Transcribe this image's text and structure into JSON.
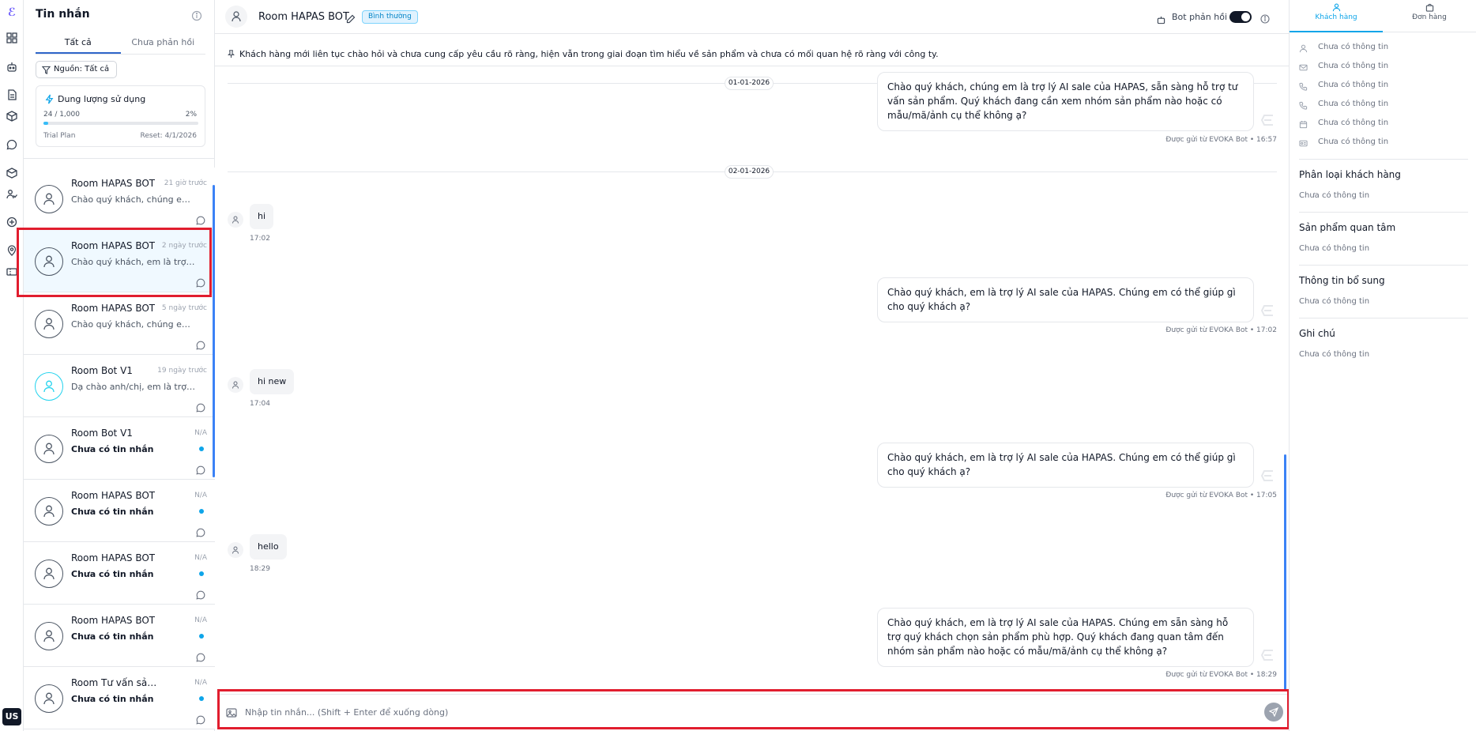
{
  "rail": {
    "user_badge": "US"
  },
  "conversations": {
    "title": "Tin nhắn",
    "tabs": [
      "Tất cả",
      "Chưa phản hồi"
    ],
    "filter_label": "Nguồn: Tất cả",
    "usage": {
      "title": "Dung lượng sử dụng",
      "count": "24 / 1,000",
      "percent_label": "2%",
      "percent": 2.4,
      "plan": "Trial Plan",
      "reset": "Reset: 4/1/2026"
    },
    "rooms": [
      {
        "name": "Room HAPAS BOT",
        "time": "21 giờ trước",
        "preview": "Chào quý khách, chúng em là trợ lý AI sale của HAPAS",
        "unread": false,
        "selected": false,
        "avatar": "gray"
      },
      {
        "name": "Room HAPAS BOT",
        "time": "2 ngày trước",
        "preview": "Chào quý khách, em là trợ lý AI sale của HAPAS",
        "unread": false,
        "selected": true,
        "avatar": "gray"
      },
      {
        "name": "Room HAPAS BOT",
        "time": "5 ngày trước",
        "preview": "Chào quý khách, chúng em là trợ lý AI sale của HAPAS",
        "unread": false,
        "selected": false,
        "avatar": "gray"
      },
      {
        "name": "Room Bot V1",
        "time": "19 ngày trước",
        "preview": "Dạ chào anh/chị, em là trợ lý AI sale",
        "unread": false,
        "selected": false,
        "avatar": "cyan"
      },
      {
        "name": "Room Bot V1",
        "time": "N/A",
        "preview": "Chưa có tin nhắn",
        "unread": true,
        "selected": false,
        "avatar": "gray"
      },
      {
        "name": "Room HAPAS BOT",
        "time": "N/A",
        "preview": "Chưa có tin nhắn",
        "unread": true,
        "selected": false,
        "avatar": "gray"
      },
      {
        "name": "Room HAPAS BOT",
        "time": "N/A",
        "preview": "Chưa có tin nhắn",
        "unread": true,
        "selected": false,
        "avatar": "gray"
      },
      {
        "name": "Room HAPAS BOT",
        "time": "N/A",
        "preview": "Chưa có tin nhắn",
        "unread": true,
        "selected": false,
        "avatar": "gray"
      },
      {
        "name": "Room Tư vấn sản phẩm mới",
        "time": "N/A",
        "preview": "Chưa có tin nhắn",
        "unread": true,
        "selected": false,
        "avatar": "gray"
      }
    ]
  },
  "chat": {
    "title": "Room HAPAS BOT",
    "badge": "Bình thường",
    "bot_reply_label": "Bot phản hồi",
    "bot_reply_on": true,
    "summary": "Khách hàng mới liên tục chào hỏi và chưa cung cấp yêu cầu rõ ràng, hiện vẫn trong giai đoạn tìm hiểu về sản phẩm và chưa có mối quan hệ rõ ràng với công ty.",
    "dates": [
      "01-01-2026",
      "02-01-2026"
    ],
    "bot_messages": [
      {
        "text": "Chào quý khách, chúng em là trợ lý AI sale của HAPAS, sẵn sàng hỗ trợ tư vấn sản phẩm. Quý khách đang cần xem nhóm sản phẩm nào hoặc có mẫu/mã/ảnh cụ thể không ạ?",
        "meta": "Được gửi từ EVOKA Bot • 16:57"
      },
      {
        "text": "Chào quý khách, em là trợ lý AI sale của HAPAS. Chúng em có thể giúp gì cho quý khách ạ?",
        "meta": "Được gửi từ EVOKA Bot • 17:02"
      },
      {
        "text": "Chào quý khách, em là trợ lý AI sale của HAPAS. Chúng em có thể giúp gì cho quý khách ạ?",
        "meta": "Được gửi từ EVOKA Bot • 17:05"
      },
      {
        "text": "Chào quý khách, em là trợ lý AI sale của HAPAS. Chúng em sẵn sàng hỗ trợ quý khách chọn sản phẩm phù hợp. Quý khách đang quan tâm đến nhóm sản phẩm nào hoặc có mẫu/mã/ảnh cụ thể không ạ?",
        "meta": "Được gửi từ EVOKA Bot • 18:29"
      }
    ],
    "user_messages": [
      {
        "text": "hi",
        "time": "17:02"
      },
      {
        "text": "hi new",
        "time": "17:04"
      },
      {
        "text": "hello",
        "time": "18:29"
      }
    ],
    "composer_placeholder": "Nhập tin nhắn... (Shift + Enter để xuống dòng)"
  },
  "side": {
    "tabs": [
      "Khách hàng",
      "Đơn hàng"
    ],
    "info_rows": [
      {
        "icon": "user-icon",
        "text": "Chưa có thông tin"
      },
      {
        "icon": "mail-icon",
        "text": "Chưa có thông tin"
      },
      {
        "icon": "phone-icon",
        "text": "Chưa có thông tin"
      },
      {
        "icon": "phone-alt-icon",
        "text": "Chưa có thông tin"
      },
      {
        "icon": "calendar-icon",
        "text": "Chưa có thông tin"
      },
      {
        "icon": "id-card-icon",
        "text": "Chưa có thông tin"
      }
    ],
    "sections": [
      {
        "title": "Phân loại khách hàng",
        "value": "Chưa có thông tin"
      },
      {
        "title": "Sản phẩm quan tâm",
        "value": "Chưa có thông tin"
      },
      {
        "title": "Thông tin bổ sung",
        "value": "Chưa có thông tin"
      },
      {
        "title": "Ghi chú",
        "value": "Chưa có thông tin"
      }
    ]
  },
  "colors": {
    "accent": "#0ea5e9",
    "highlight": "#e11d2e",
    "scroll": "#3b82f6"
  }
}
